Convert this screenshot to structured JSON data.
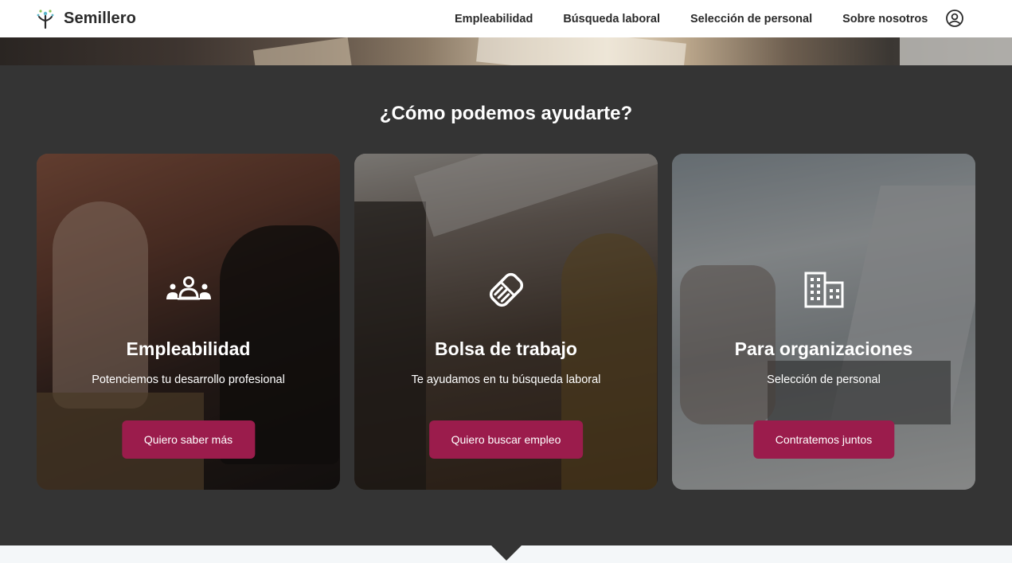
{
  "header": {
    "brand_name": "Semillero",
    "logo_icon": "sprout-icon",
    "nav": [
      {
        "label": "Empleabilidad"
      },
      {
        "label": "Búsqueda laboral"
      },
      {
        "label": "Selección de personal"
      },
      {
        "label": "Sobre nosotros"
      }
    ],
    "user_icon": "user-circle-icon"
  },
  "section": {
    "title": "¿Cómo podemos ayudarte?"
  },
  "cards": [
    {
      "icon": "group-users-icon",
      "title": "Empleabilidad",
      "subtitle": "Potenciemos tu desarrollo profesional",
      "button": "Quiero saber más"
    },
    {
      "icon": "handshake-icon",
      "title": "Bolsa de trabajo",
      "subtitle": "Te ayudamos en tu búsqueda laboral",
      "button": "Quiero buscar empleo"
    },
    {
      "icon": "building-icon",
      "title": "Para organizaciones",
      "subtitle": "Selección de personal",
      "button": "Contratemos juntos"
    }
  ],
  "colors": {
    "accent": "#9b1c4c",
    "section_bg": "#343434",
    "header_bg": "#ffffff"
  }
}
